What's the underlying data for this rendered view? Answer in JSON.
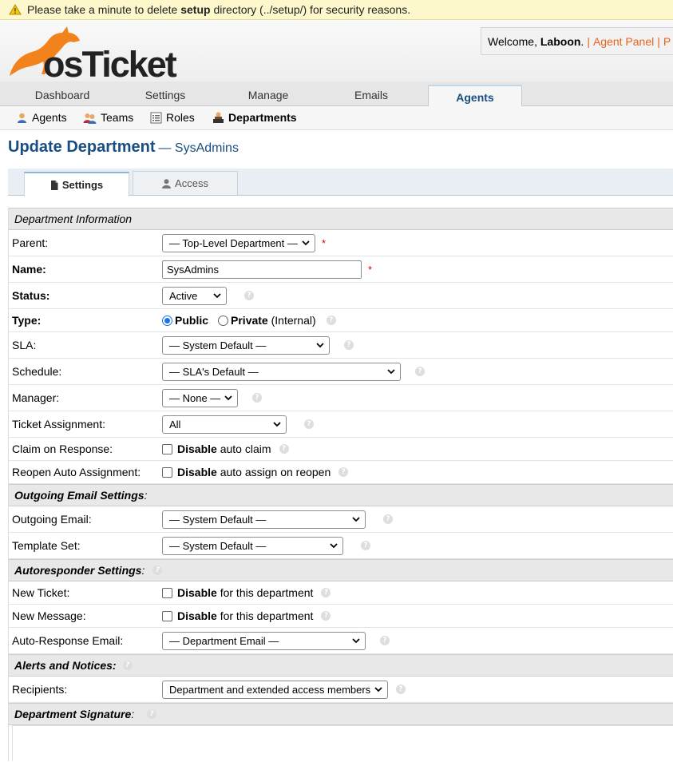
{
  "warning": {
    "prefix": "Please take a minute to delete",
    "dir": "setup",
    "suffix": "directory (../setup/) for security reasons."
  },
  "header": {
    "logo_text": "osTicket",
    "welcome_prefix": "Welcome,",
    "user": "Laboon",
    "agent_panel": "Agent Panel",
    "separator": "|",
    "cut_link": "P"
  },
  "nav": {
    "tabs": [
      "Dashboard",
      "Settings",
      "Manage",
      "Emails",
      "Agents"
    ],
    "active": "Agents"
  },
  "subnav": {
    "items": [
      "Agents",
      "Teams",
      "Roles",
      "Departments"
    ],
    "active": "Departments"
  },
  "page": {
    "title": "Update Department",
    "subtitle": "— SysAdmins"
  },
  "form_tabs": {
    "settings": "Settings",
    "access": "Access"
  },
  "sections": {
    "dept_info": "Department Information",
    "outgoing": "Outgoing Email Settings",
    "autoresponder": "Autoresponder Settings",
    "alerts": "Alerts and Notices:",
    "signature": "Department Signature"
  },
  "colon": ":",
  "fields": {
    "parent": {
      "label": "Parent:",
      "value": "— Top-Level Department —",
      "req": "*"
    },
    "name": {
      "label": "Name:",
      "value": "SysAdmins",
      "req": "*"
    },
    "status": {
      "label": "Status:",
      "value": "Active"
    },
    "type": {
      "label": "Type:",
      "public": "Public",
      "private": "Private",
      "internal": "(Internal)"
    },
    "sla": {
      "label": "SLA:",
      "value": "— System Default —"
    },
    "schedule": {
      "label": "Schedule:",
      "value": "— SLA's Default —"
    },
    "manager": {
      "label": "Manager:",
      "value": "— None —"
    },
    "ticket_assignment": {
      "label": "Ticket Assignment:",
      "value": "All"
    },
    "claim": {
      "label": "Claim on Response:",
      "bold": "Disable",
      "rest": "auto claim"
    },
    "reopen": {
      "label": "Reopen Auto Assignment:",
      "bold": "Disable",
      "rest": "auto assign on reopen"
    },
    "outgoing_email": {
      "label": "Outgoing Email:",
      "value": "— System Default —"
    },
    "template_set": {
      "label": "Template Set:",
      "value": "— System Default —"
    },
    "new_ticket": {
      "label": "New Ticket:",
      "bold": "Disable",
      "rest": "for this department"
    },
    "new_message": {
      "label": "New Message:",
      "bold": "Disable",
      "rest": "for this department"
    },
    "auto_response_email": {
      "label": "Auto-Response Email:",
      "value": "— Department Email —"
    },
    "recipients": {
      "label": "Recipients:",
      "value": "Department and extended access members"
    }
  },
  "help_glyph": "?",
  "colors": {
    "brand_orange": "#e8631c",
    "title_blue": "#184e81"
  }
}
